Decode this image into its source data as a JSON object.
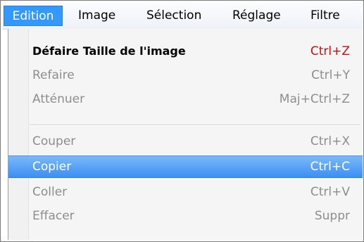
{
  "menubar": {
    "items": [
      {
        "label": "Edition",
        "active": true
      },
      {
        "label": "Image"
      },
      {
        "label": "Sélection"
      },
      {
        "label": "Réglage"
      },
      {
        "label": "Filtre"
      }
    ]
  },
  "menu": {
    "items": [
      {
        "label": "Défaire Taille de l'image",
        "shortcut": "Ctrl+Z",
        "state": "enabled"
      },
      {
        "label": "Refaire",
        "shortcut": "Ctrl+Y",
        "state": "disabled"
      },
      {
        "label": "Atténuer",
        "shortcut": "Maj+Ctrl+Z",
        "state": "disabled"
      },
      {
        "label": "Couper",
        "shortcut": "Ctrl+X",
        "state": "disabled"
      },
      {
        "label": "Copier",
        "shortcut": "Ctrl+C",
        "state": "highlighted"
      },
      {
        "label": "Coller",
        "shortcut": "Ctrl+V",
        "state": "disabled"
      },
      {
        "label": "Effacer",
        "shortcut": "Suppr",
        "state": "disabled"
      }
    ]
  },
  "colors": {
    "highlight": "#3d8ff2",
    "shortcut_enabled": "#c21212",
    "disabled_text": "#8d8d8d"
  }
}
